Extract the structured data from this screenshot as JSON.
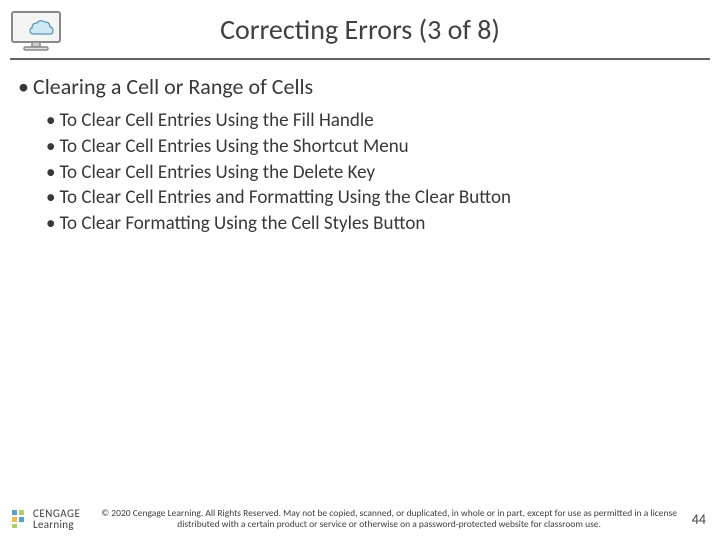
{
  "title": "Correcting Errors (3 of 8)",
  "heading": "Clearing a Cell or Range of Cells",
  "items": [
    "To Clear Cell Entries Using the Fill Handle",
    "To Clear Cell Entries Using the Shortcut Menu",
    "To Clear Cell Entries Using the Delete Key",
    "To Clear Cell Entries and Formatting Using the Clear Button",
    "To Clear Formatting Using the Cell Styles Button"
  ],
  "logo": {
    "top": "CENGAGE",
    "bottom": "Learning"
  },
  "copyright": "© 2020 Cengage Learning. All Rights Reserved. May not be copied, scanned, or duplicated, in whole or in part, except for use as permitted in a license distributed with a certain product or service or otherwise on a password-protected website for classroom use.",
  "page": "44"
}
